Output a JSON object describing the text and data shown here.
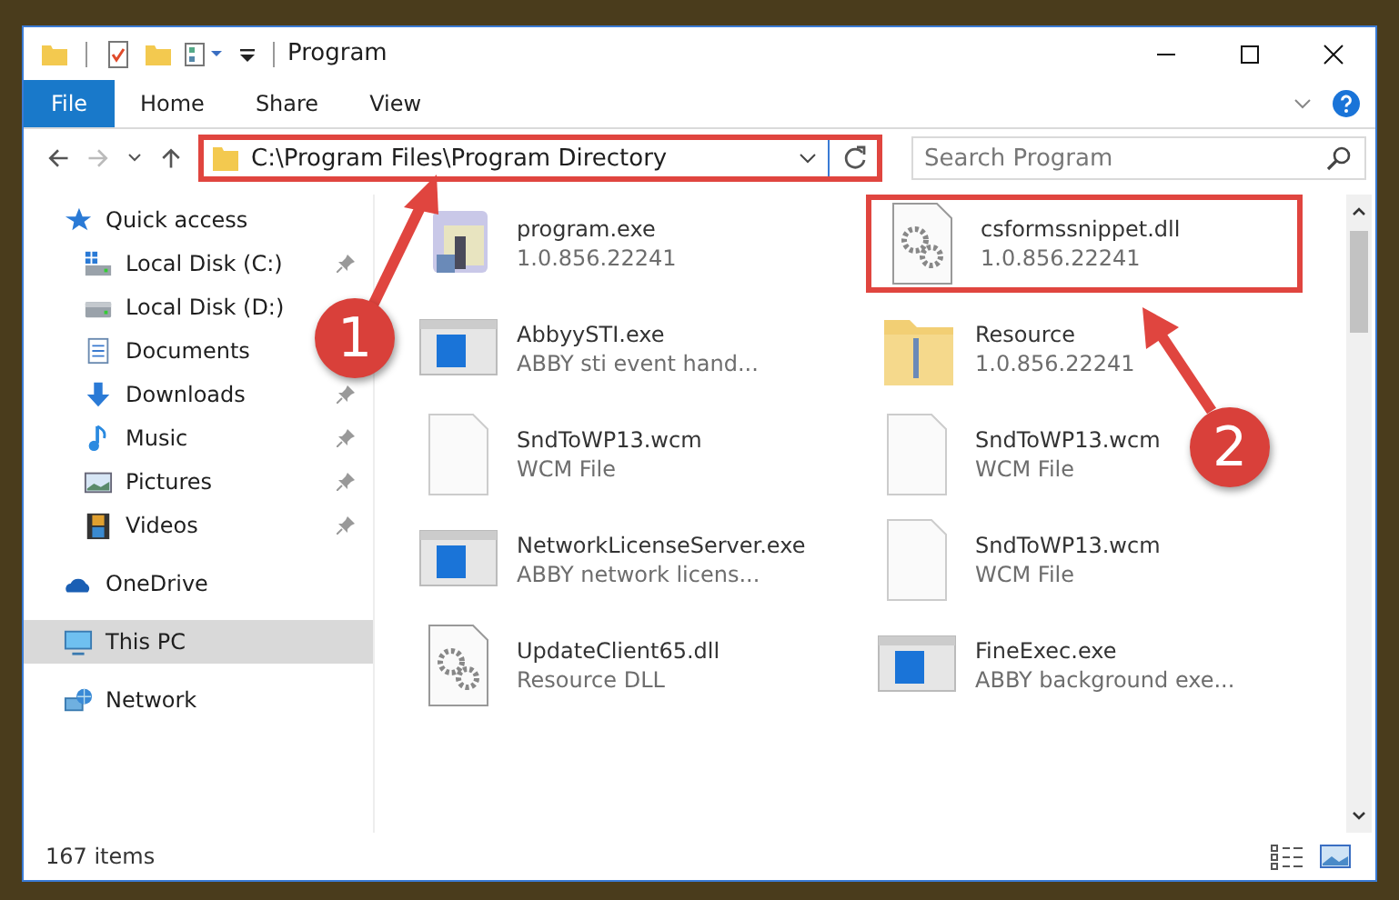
{
  "window": {
    "title": "Program"
  },
  "ribbon_tabs": [
    {
      "label": "File",
      "kind": "file"
    },
    {
      "label": "Home",
      "kind": "tab"
    },
    {
      "label": "Share",
      "kind": "tab"
    },
    {
      "label": "View",
      "kind": "tab"
    }
  ],
  "address_bar": {
    "path": "C:\\Program Files\\Program Directory",
    "highlighted": true
  },
  "search": {
    "placeholder": "Search Program"
  },
  "sidebar": {
    "items": [
      {
        "label": "Quick access",
        "kind": "star",
        "selected": false,
        "children": [
          {
            "label": "Local Disk (C:)",
            "kind": "system-drive",
            "pinned": true,
            "selected": false
          },
          {
            "label": "Local Disk (D:)",
            "kind": "drive",
            "pinned": false,
            "selected": false
          },
          {
            "label": "Documents",
            "kind": "documents",
            "pinned": false,
            "selected": false
          },
          {
            "label": "Downloads",
            "kind": "downloads",
            "pinned": true,
            "selected": false
          },
          {
            "label": "Music",
            "kind": "music",
            "pinned": true,
            "selected": false
          },
          {
            "label": "Pictures",
            "kind": "pictures",
            "pinned": true,
            "selected": false
          },
          {
            "label": "Videos",
            "kind": "videos",
            "pinned": true,
            "selected": false
          }
        ]
      },
      {
        "label": "OneDrive",
        "kind": "cloud",
        "selected": false
      },
      {
        "label": "This PC",
        "kind": "pc",
        "selected": true
      },
      {
        "label": "Network",
        "kind": "network",
        "selected": false
      }
    ]
  },
  "files": [
    {
      "name": "program.exe",
      "detail": "1.0.856.22241",
      "kind": "installer",
      "highlighted": false
    },
    {
      "name": "csformssnippet.dll",
      "detail": "1.0.856.22241",
      "kind": "dll",
      "highlighted": true
    },
    {
      "name": "AbbyySTI.exe",
      "detail": "ABBY sti event hand...",
      "kind": "app",
      "highlighted": false
    },
    {
      "name": "Resource",
      "detail": "1.0.856.22241",
      "kind": "folder",
      "highlighted": false
    },
    {
      "name": "SndToWP13.wcm",
      "detail": "WCM File",
      "kind": "document",
      "highlighted": false
    },
    {
      "name": "SndToWP13.wcm",
      "detail": "WCM File",
      "kind": "document",
      "highlighted": false
    },
    {
      "name": "NetworkLicenseServer.exe",
      "detail": "ABBY network licens...",
      "kind": "app",
      "highlighted": false
    },
    {
      "name": "SndToWP13.wcm",
      "detail": "WCM File",
      "kind": "document",
      "highlighted": false
    },
    {
      "name": "UpdateClient65.dll",
      "detail": "Resource DLL",
      "kind": "dll",
      "highlighted": false
    },
    {
      "name": "FineExec.exe",
      "detail": "ABBY background exe...",
      "kind": "app",
      "highlighted": false
    }
  ],
  "annotations": [
    {
      "label": "1"
    },
    {
      "label": "2"
    }
  ],
  "status_bar": {
    "item_count": "167 items"
  }
}
